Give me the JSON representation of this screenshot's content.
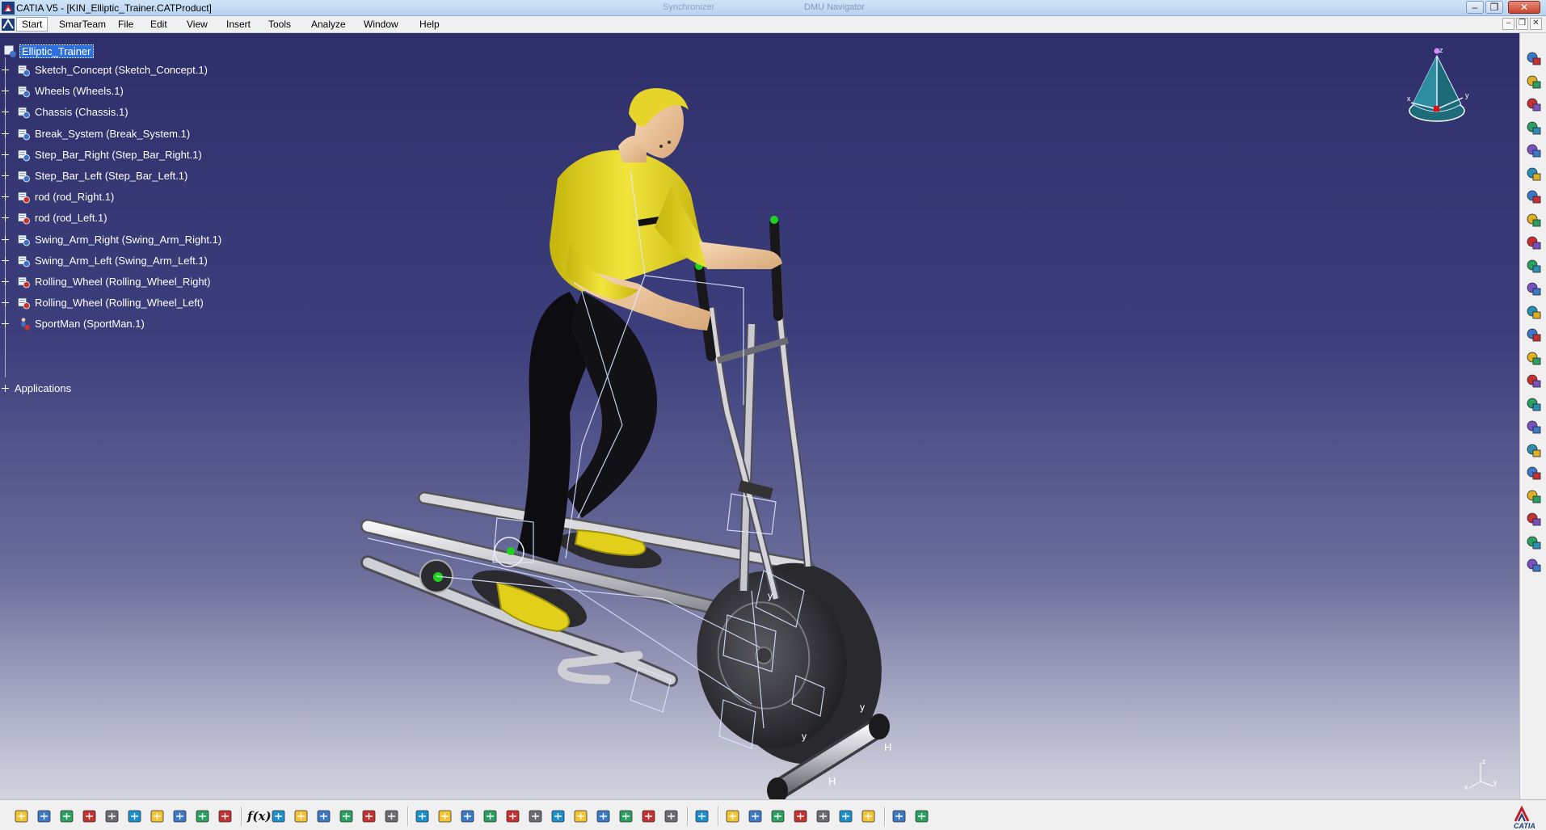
{
  "window": {
    "title": "CATIA V5 - [KIN_Elliptic_Trainer.CATProduct]",
    "background_tabs": [
      "",
      "",
      "",
      "Synchronizer",
      "DMU Navigator"
    ],
    "controls": {
      "minimize": "–",
      "maximize": "❐",
      "close": "✕"
    },
    "mdi_controls": {
      "minimize": "–",
      "restore": "❐",
      "close": "✕"
    }
  },
  "menu": {
    "start": "Start",
    "items": [
      "SmarTeam",
      "File",
      "Edit",
      "View",
      "Insert",
      "Tools",
      "Analyze",
      "Window",
      "Help"
    ]
  },
  "tree": {
    "root": "Elliptic_Trainer",
    "items": [
      {
        "label": "Sketch_Concept (Sketch_Concept.1)",
        "icon": "product-icon"
      },
      {
        "label": "Wheels (Wheels.1)",
        "icon": "product-icon"
      },
      {
        "label": "Chassis (Chassis.1)",
        "icon": "product-icon"
      },
      {
        "label": "Break_System (Break_System.1)",
        "icon": "product-icon"
      },
      {
        "label": "Step_Bar_Right (Step_Bar_Right.1)",
        "icon": "product-icon"
      },
      {
        "label": "Step_Bar_Left (Step_Bar_Left.1)",
        "icon": "product-icon"
      },
      {
        "label": "rod (rod_Right.1)",
        "icon": "part-icon"
      },
      {
        "label": "rod (rod_Left.1)",
        "icon": "part-icon"
      },
      {
        "label": "Swing_Arm_Right (Swing_Arm_Right.1)",
        "icon": "product-icon"
      },
      {
        "label": "Swing_Arm_Left (Swing_Arm_Left.1)",
        "icon": "product-icon"
      },
      {
        "label": "Rolling_Wheel (Rolling_Wheel_Right)",
        "icon": "part-icon"
      },
      {
        "label": "Rolling_Wheel (Rolling_Wheel_Left)",
        "icon": "part-icon"
      },
      {
        "label": "SportMan (SportMan.1)",
        "icon": "manikin-icon"
      }
    ],
    "applications": "Applications"
  },
  "viewport": {
    "compass_labels": {
      "x": "x",
      "y": "y",
      "z": "z"
    },
    "axis_labels": {
      "x": "x",
      "y": "y",
      "z": "z"
    },
    "scene_annotations": [
      "H",
      "H",
      "y",
      "y",
      "y"
    ],
    "colors": {
      "background_top": "#2e2f6a",
      "background_bottom": "#d3d4de",
      "shirt": "#e6d81e",
      "skin": "#f0c9a0",
      "pants": "#0c0c10",
      "frame": "#c9c9cf",
      "constraint": "#d8e6ff"
    }
  },
  "toolbars": {
    "right": [
      "rotate-icon",
      "select-arrow-icon",
      "fit-product-icon",
      "sensor-icon",
      "assembly-icon",
      "gear-icon",
      "joint-icon",
      "revolute-joint-icon",
      "cylindrical-joint-icon",
      "gear-joint-icon",
      "simulation-icon",
      "clash-icon",
      "analysis-icon",
      "measure-icon",
      "law-icon",
      "kinematics-icon",
      "trace-icon",
      "swept-volume-icon",
      "sequence-icon",
      "player-icon",
      "compile-icon",
      "replay-icon",
      "speed-icon"
    ],
    "bottom": [
      "new-icon",
      "open-icon",
      "save-icon",
      "print-icon",
      "cut-icon",
      "copy-icon",
      "paste-icon",
      "undo-icon",
      "redo-icon",
      "whats-this-icon",
      "formula-icon",
      "comment-icon",
      "knowledge-icon",
      "table-icon",
      "network-icon",
      "lock-icon",
      "tools-icon",
      "fly-mode-icon",
      "fit-all-icon",
      "pan-icon",
      "rotate-view-icon",
      "zoom-in-icon",
      "zoom-out-icon",
      "normal-view-icon",
      "multi-view-icon",
      "iso-view-icon",
      "hide-show-icon",
      "swap-space-icon",
      "render-icon",
      "capture-icon",
      "compass-icon",
      "rewind-icon",
      "forward-icon",
      "magnify-icon",
      "sectioning-icon",
      "lighting-icon",
      "shading-icon",
      "exchange-icon",
      "switch-icon"
    ],
    "fx_label": "f(x)"
  },
  "brand": {
    "name": "CATIA"
  }
}
